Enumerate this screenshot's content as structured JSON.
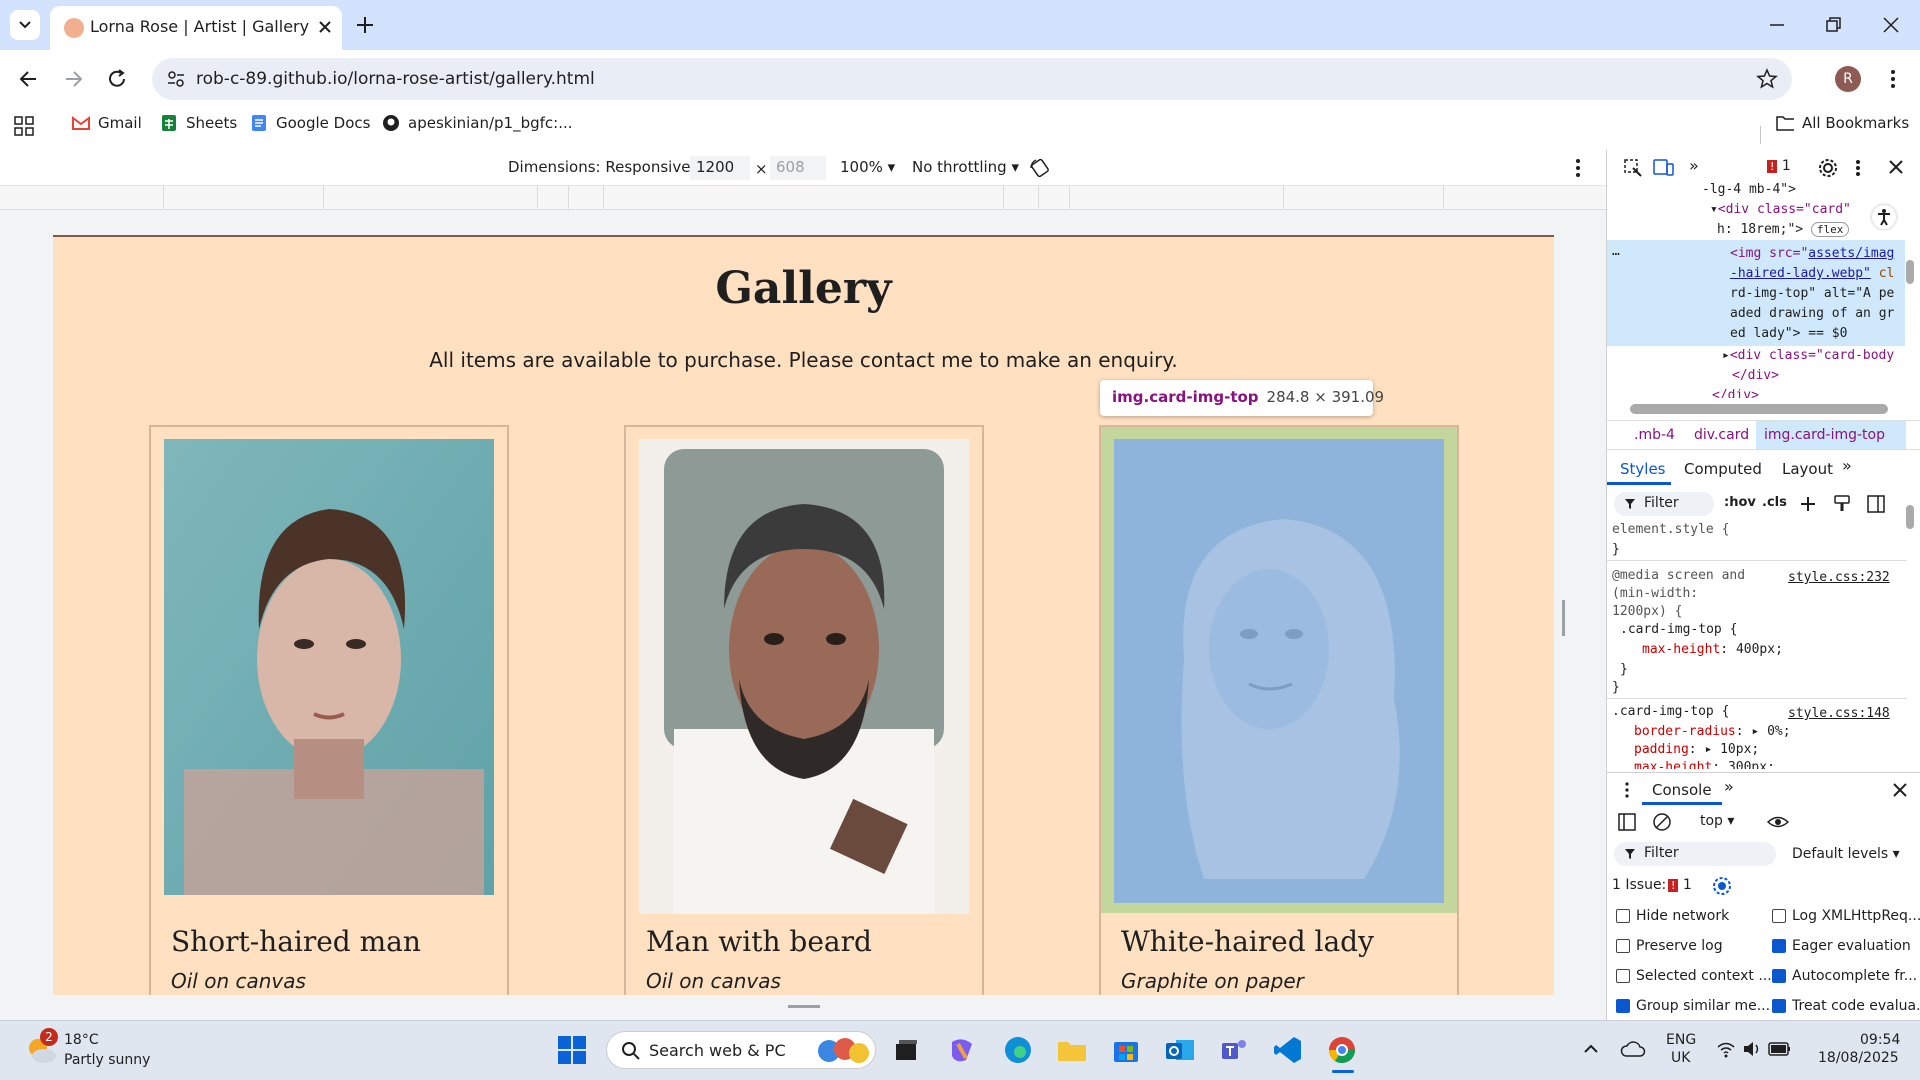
{
  "browser": {
    "tab_title": "Lorna Rose | Artist | Gallery",
    "url": "rob-c-89.github.io/lorna-rose-artist/gallery.html",
    "avatar_letter": "R",
    "bookmarks": [
      "Gmail",
      "Sheets",
      "Google Docs",
      "apeskinian/p1_bgfc:..."
    ],
    "all_bookmarks": "All Bookmarks"
  },
  "device_toolbar": {
    "dimensions_label": "Dimensions: Responsive",
    "width": "1200",
    "times": "×",
    "height": "608",
    "zoom": "100%",
    "throttling": "No throttling"
  },
  "page": {
    "title": "Gallery",
    "subtitle": "All items are available to purchase. Please contact me to make an enquiry.",
    "cards": [
      {
        "title": "Short-haired man",
        "medium": "Oil on canvas"
      },
      {
        "title": "Man with beard",
        "medium": "Oil on canvas"
      },
      {
        "title": "White-haired lady",
        "medium": "Graphite on paper"
      }
    ]
  },
  "tooltip": {
    "selector": "img.card-img-top",
    "dimensions": "284.8 × 391.09"
  },
  "devtools": {
    "issue_count": "1",
    "dom": {
      "line1": "-lg-4 mb-4\">",
      "line2a": "<div class=\"card\"",
      "line2b": "h: 18rem;\">",
      "flex_badge": "flex",
      "img_line1_tag": "<img src=\"",
      "img_line1_link": "assets/imag",
      "img_line2": "-haired-lady.webp\"",
      "img_line2b": " cl",
      "img_line3": "rd-img-top\" alt=\"A pe",
      "img_line4": "aded drawing of an gr",
      "img_line5": "ed lady\"> == $0",
      "line_div": "<div class=\"card-body",
      "line_close": "</div>",
      "line_close2": "</div>"
    },
    "breadcrumbs": [
      ".mb-4",
      "div.card",
      "img.card-img-top"
    ],
    "style_tabs": [
      "Styles",
      "Computed",
      "Layout"
    ],
    "filter_placeholder": "Filter",
    "hov": ":hov",
    "cls": ".cls",
    "styles": {
      "element_style": "element.style {",
      "close_brace": "}",
      "media_line1": "@media screen and",
      "media_line2": "(min-width:",
      "media_line3": "1200px) {",
      "media_source": "style.css:232",
      "rule1_selector": ".card-img-top {",
      "rule1_prop": "max-height",
      "rule1_value": "400px;",
      "rule2_selector": ".card-img-top {",
      "rule2_source": "style.css:148",
      "rule2_prop1": "border-radius",
      "rule2_val1": "0%;",
      "rule2_prop2": "padding",
      "rule2_val2": "10px;",
      "rule2_prop3": "max-height",
      "rule2_val3": "300px;"
    },
    "console": {
      "tab": "Console",
      "context": "top",
      "filter_placeholder": "Filter",
      "levels": "Default levels",
      "issues_label": "1 Issue:",
      "issues_count": "1",
      "options": [
        {
          "label": "Hide network",
          "checked": false
        },
        {
          "label": "Log XMLHttpReq...",
          "checked": false
        },
        {
          "label": "Preserve log",
          "checked": false
        },
        {
          "label": "Eager evaluation",
          "checked": true
        },
        {
          "label": "Selected context ...",
          "checked": false
        },
        {
          "label": "Autocomplete fr...",
          "checked": true
        },
        {
          "label": "Group similar me...",
          "checked": true
        },
        {
          "label": "Treat code evalua...",
          "checked": true
        }
      ]
    }
  },
  "taskbar": {
    "weather_temp": "18°C",
    "weather_desc": "Partly sunny",
    "weather_badge": "2",
    "search_placeholder": "Search web & PC",
    "lang1": "ENG",
    "lang2": "UK",
    "time": "09:54",
    "date": "18/08/2025"
  }
}
